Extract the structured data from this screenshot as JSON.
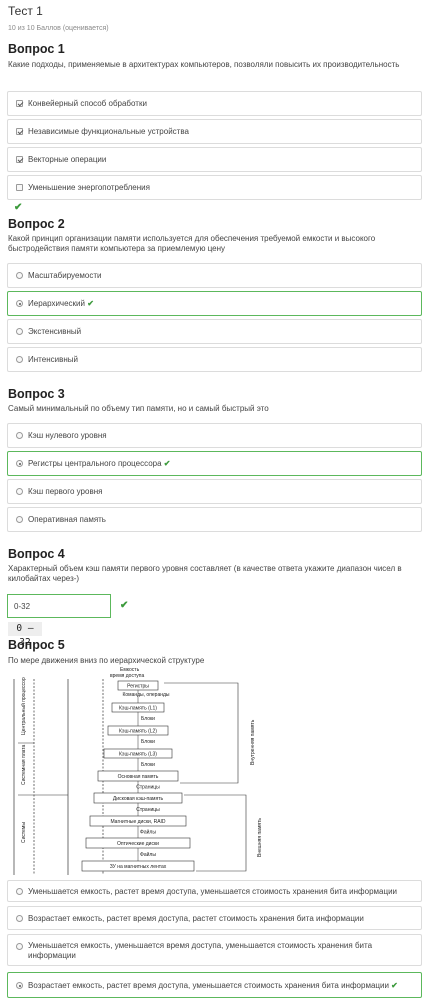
{
  "test": {
    "title": "Тест 1",
    "score": "10 из 10 Баллов (оценивается)"
  },
  "questions": [
    {
      "title": "Вопрос 1",
      "text": "Какие подходы, применяемые в архитектурах компьютеров, позволяли повысить их производительность",
      "type": "checkbox",
      "options": [
        {
          "label": "Конвейерный способ обработки",
          "checked": true
        },
        {
          "label": "Независимые функциональные устройства",
          "checked": true
        },
        {
          "label": "Векторные операции",
          "checked": true
        },
        {
          "label": "Уменьшение энергопотребления",
          "checked": false
        }
      ]
    },
    {
      "title": "Вопрос 2",
      "text": "Какой принцип организации памяти используется для обеспечения требуемой емкости и высокого быстродействия памяти компьютера за приемлемую цену",
      "type": "radio",
      "options": [
        {
          "label": "Масштабируемости",
          "checked": false
        },
        {
          "label": "Иерархический",
          "checked": true
        },
        {
          "label": "Экстенсивный",
          "checked": false
        },
        {
          "label": "Интенсивный",
          "checked": false
        }
      ]
    },
    {
      "title": "Вопрос 3",
      "text": "Самый минимальный по объему тип памяти, но и самый быстрый это",
      "type": "radio",
      "options": [
        {
          "label": "Кэш нулевого уровня",
          "checked": false
        },
        {
          "label": "Регистры центрального процессора",
          "checked": true
        },
        {
          "label": "Кэш первого уровня",
          "checked": false
        },
        {
          "label": "Оперативная память",
          "checked": false
        }
      ]
    },
    {
      "title": "Вопрос 4",
      "text": "Характерный объем кэш памяти первого уровня составляет (в качестве ответа укажите диапазон чисел в килобайтах через-)",
      "input_value": "0-32",
      "correct_answer": "0 – 32"
    },
    {
      "title": "Вопрос 5",
      "text": "По мере движения вниз по иерархической структуре",
      "type": "radio",
      "options": [
        {
          "label": "Уменьшается емкость, растет время доступа, уменьшается стоимость хранения бита информации",
          "checked": false
        },
        {
          "label": "Возрастает емкость, растет время доступа, растет стоимость хранения бита информации",
          "checked": false
        },
        {
          "label": "Уменьшается емкость, уменьшается время доступа, уменьшается стоимость хранения бита информации",
          "checked": false
        },
        {
          "label": "Возрастает емкость, растет время доступа, уменьшается стоимость хранения бита информации",
          "checked": true
        }
      ]
    }
  ],
  "diagram": {
    "top_note": "Емкость время доступа",
    "levels": [
      "Регистры",
      "Кэш-память (L1)",
      "Кэш-память (L2)",
      "Кэш-память (L3)",
      "Основная память",
      "Дисковая кэш-память",
      "Магнитные диски, RAID",
      "Оптические диски",
      "ЗУ на магнитных лентах"
    ],
    "transfers": [
      "Команды, операнды",
      "Блоки",
      "Блоки",
      "Блоки",
      "Страницы",
      "Страницы",
      "Файлы",
      "Файлы"
    ],
    "left_labels": [
      "Центральный процессор",
      "Системная плата",
      "Системы"
    ],
    "right_labels": [
      "Внутренняя память",
      "Внешняя память"
    ]
  },
  "colors": {
    "correct": "#5cb85c",
    "border": "#dcdcdc"
  }
}
